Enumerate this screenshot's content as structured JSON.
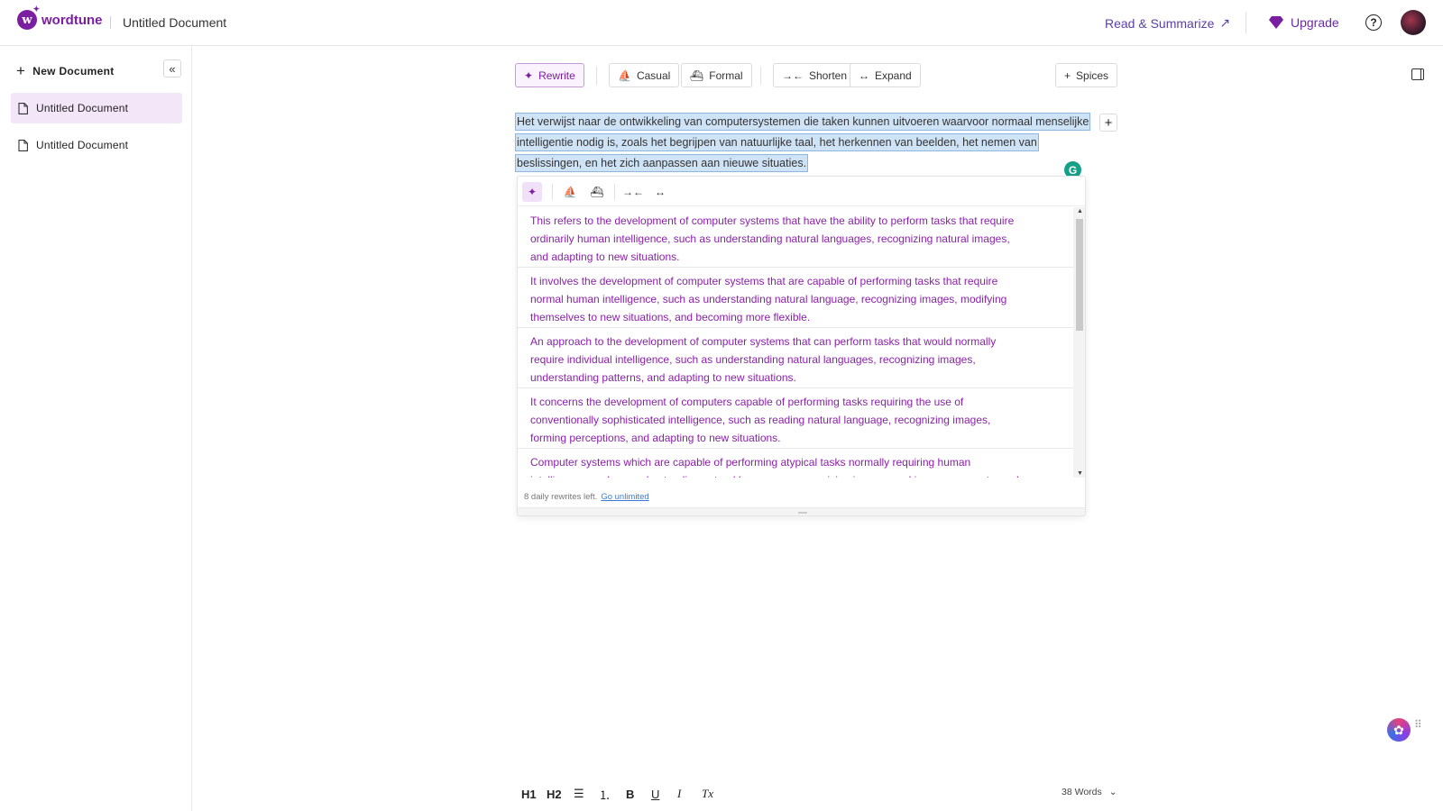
{
  "header": {
    "brand": "wordtune",
    "doc_title": "Untitled Document",
    "read_summarize": "Read & Summarize",
    "upgrade": "Upgrade",
    "help_glyph": "?"
  },
  "sidebar": {
    "new_document": "New Document",
    "documents": [
      {
        "label": "Untitled Document",
        "active": true
      },
      {
        "label": "Untitled Document",
        "active": false
      }
    ]
  },
  "toolbar": {
    "rewrite": "Rewrite",
    "casual": "Casual",
    "formal": "Formal",
    "shorten": "Shorten",
    "expand": "Expand",
    "spices": "Spices"
  },
  "editor": {
    "text": "Het verwijst naar de ontwikkeling van computersystemen die taken kunnen uitvoeren waarvoor normaal menselijke intelligentie nodig is, zoals het begrijpen van natuurlijke taal, het herkennen van beelden, het nemen van beslissingen, en het zich aanpassen aan nieuwe situaties."
  },
  "suggestions": {
    "items": [
      "This refers to the development of computer systems that have the ability to perform tasks that require ordinarily human intelligence, such as understanding natural languages, recognizing natural images, and adapting to new situations.",
      "It involves the development of computer systems that are capable of performing tasks that require normal human intelligence, such as understanding natural language, recognizing images, modifying themselves to new situations, and becoming more flexible.",
      "An approach to the development of computer systems that can perform tasks that would normally require individual intelligence, such as understanding natural languages, recognizing images, understanding patterns, and adapting to new situations.",
      "It concerns the development of computers capable of performing tasks requiring the use of conventionally sophisticated intelligence, such as reading natural language, recognizing images, forming perceptions, and adapting to new situations.",
      "Computer systems which are capable of performing atypical tasks normally requiring human intelligence, such as understanding natural languages, recognizing images, making assessments, and"
    ],
    "rewrites_left": "8 daily rewrites left.",
    "go_unlimited": "Go unlimited"
  },
  "format_bar": {
    "h1": "H1",
    "h2": "H2",
    "bold": "B",
    "underline": "U",
    "italic": "I",
    "clear": "Tx",
    "word_count": "38 Words"
  },
  "colors": {
    "brand": "#7b1fa2",
    "suggestion_text": "#8a22a8",
    "selection": "#cfe3f7",
    "active_doc_bg": "#f3e6f9"
  }
}
